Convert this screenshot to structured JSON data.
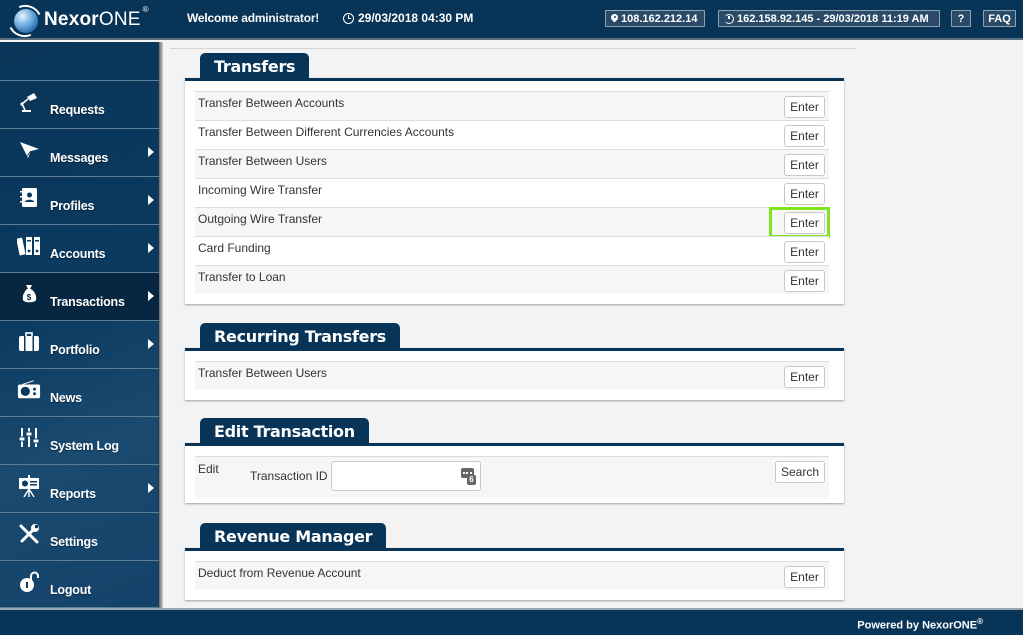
{
  "header": {
    "logo_bold": "Nexor",
    "logo_thin": "ONE",
    "logo_reg": "®",
    "welcome_prefix": "Welcome",
    "welcome_user": "administrator!",
    "datetime": "29/03/2018 04:30 PM",
    "ip_address": "108.162.212.14",
    "last_login": "162.158.92.145 - 29/03/2018 11:19 AM",
    "help_label": "?",
    "faq_label": "FAQ"
  },
  "sidebar": {
    "items": [
      {
        "label": "Requests",
        "icon": "desk-lamp-icon",
        "has_submenu": false,
        "active": false
      },
      {
        "label": "Messages",
        "icon": "paper-plane-icon",
        "has_submenu": true,
        "active": false
      },
      {
        "label": "Profiles",
        "icon": "contact-book-icon",
        "has_submenu": true,
        "active": false
      },
      {
        "label": "Accounts",
        "icon": "binders-icon",
        "has_submenu": true,
        "active": false
      },
      {
        "label": "Transactions",
        "icon": "money-bag-icon",
        "has_submenu": true,
        "active": true
      },
      {
        "label": "Portfolio",
        "icon": "briefcase-icon",
        "has_submenu": true,
        "active": false
      },
      {
        "label": "News",
        "icon": "radio-icon",
        "has_submenu": false,
        "active": false
      },
      {
        "label": "System Log",
        "icon": "sliders-icon",
        "has_submenu": false,
        "active": false
      },
      {
        "label": "Reports",
        "icon": "presentation-board-icon",
        "has_submenu": true,
        "active": false
      },
      {
        "label": "Settings",
        "icon": "wrench-screwdriver-icon",
        "has_submenu": false,
        "active": false
      },
      {
        "label": "Logout",
        "icon": "unlocked-padlock-icon",
        "has_submenu": false,
        "active": false
      }
    ]
  },
  "panels": {
    "transfers": {
      "title": "Transfers",
      "rows": [
        {
          "label": "Transfer Between Accounts",
          "button": "Enter"
        },
        {
          "label": "Transfer Between Different Currencies Accounts",
          "button": "Enter"
        },
        {
          "label": "Transfer Between Users",
          "button": "Enter"
        },
        {
          "label": "Incoming Wire Transfer",
          "button": "Enter"
        },
        {
          "label": "Outgoing Wire Transfer",
          "button": "Enter",
          "highlighted": true
        },
        {
          "label": "Card Funding",
          "button": "Enter"
        },
        {
          "label": "Transfer to Loan",
          "button": "Enter"
        }
      ]
    },
    "recurring": {
      "title": "Recurring Transfers",
      "rows": [
        {
          "label": "Transfer Between Users",
          "button": "Enter"
        }
      ]
    },
    "edit": {
      "title": "Edit Transaction",
      "row_label": "Edit",
      "field_label": "Transaction ID",
      "field_value": "",
      "field_placeholder": "",
      "keypad_badge": "6",
      "button": "Search"
    },
    "revenue": {
      "title": "Revenue Manager",
      "rows": [
        {
          "label": "Deduct from Revenue Account",
          "button": "Enter"
        }
      ]
    }
  },
  "footer": {
    "powered_by": "Powered by NexorONE",
    "reg": "®"
  },
  "colors": {
    "brand_navy": "#083457",
    "highlight_green": "#7ee51e"
  }
}
